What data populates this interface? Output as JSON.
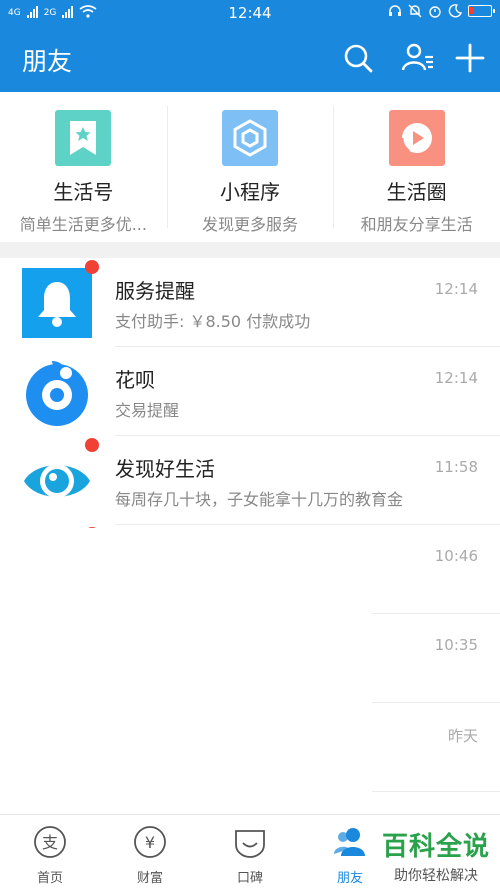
{
  "status": {
    "left_labels": [
      "4G",
      "2G"
    ],
    "time": "12:44"
  },
  "header": {
    "title": "朋友",
    "search_icon": "search-icon",
    "contacts_icon": "contacts-icon",
    "add_icon": "plus-icon"
  },
  "tiles": [
    {
      "title": "生活号",
      "subtitle": "简单生活更多优...",
      "color": "#5fd2c8",
      "icon": "bookmark-star-icon"
    },
    {
      "title": "小程序",
      "subtitle": "发现更多服务",
      "color": "#7ec0f5",
      "icon": "mini-program-icon"
    },
    {
      "title": "生活圈",
      "subtitle": "和朋友分享生活",
      "color": "#f8917f",
      "icon": "life-circle-icon"
    }
  ],
  "messages": [
    {
      "title": "服务提醒",
      "subtitle": "支付助手: ￥8.50 付款成功",
      "time": "12:14",
      "badge": true
    },
    {
      "title": "花呗",
      "subtitle": "交易提醒",
      "time": "12:14",
      "badge": false
    },
    {
      "title": "发现好生活",
      "subtitle": "每周存几十块，子女能拿十几万的教育金",
      "time": "11:58",
      "badge": true
    },
    {
      "title": "",
      "subtitle": "",
      "time": "10:46",
      "badge": true
    },
    {
      "title": "",
      "subtitle": "",
      "time": "10:35",
      "badge": false
    },
    {
      "title": "",
      "subtitle": "",
      "time": "昨天",
      "badge": false
    }
  ],
  "bottom_nav": [
    {
      "label": "首页",
      "icon": "home-icon"
    },
    {
      "label": "财富",
      "icon": "wealth-icon"
    },
    {
      "label": "口碑",
      "icon": "koubei-icon"
    },
    {
      "label": "朋友",
      "icon": "friends-icon",
      "active": true
    }
  ],
  "watermark": {
    "title": "百科全说",
    "subtitle": "助你轻松解决"
  },
  "colors": {
    "brand": "#1a88dc",
    "badge": "#f04134"
  }
}
